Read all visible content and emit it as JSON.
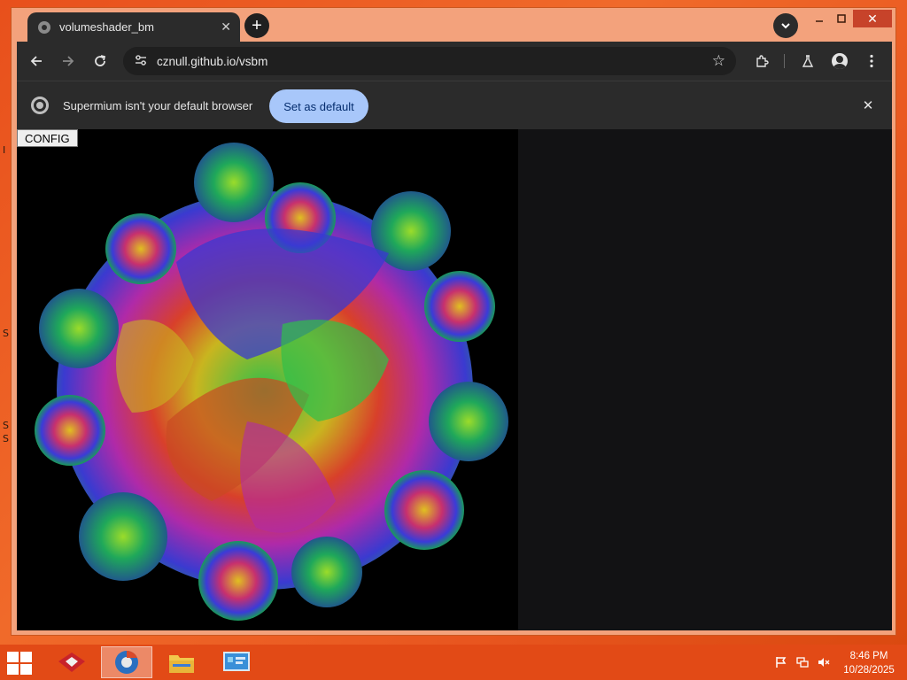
{
  "desktop": {
    "edge_glyphs": [
      "I",
      "S",
      "S",
      "S"
    ]
  },
  "tab": {
    "title": "volumeshader_bm"
  },
  "omnibox": {
    "url": "cznull.github.io/vsbm"
  },
  "infobar": {
    "message": "Supermium isn't your default browser",
    "button_label": "Set as default"
  },
  "page": {
    "config_label": "CONFIG"
  },
  "taskbar": {
    "items": [
      "app-launcher",
      "supermium-browser",
      "file-explorer",
      "control-panel"
    ],
    "clock_time": "8:46 PM",
    "clock_date": "10/28/2025"
  },
  "colors": {
    "desktop": "#e8501c",
    "browser_frame": "#2b2b2b",
    "accent_button": "#a8c7fa",
    "taskbar": "#e24a16"
  }
}
